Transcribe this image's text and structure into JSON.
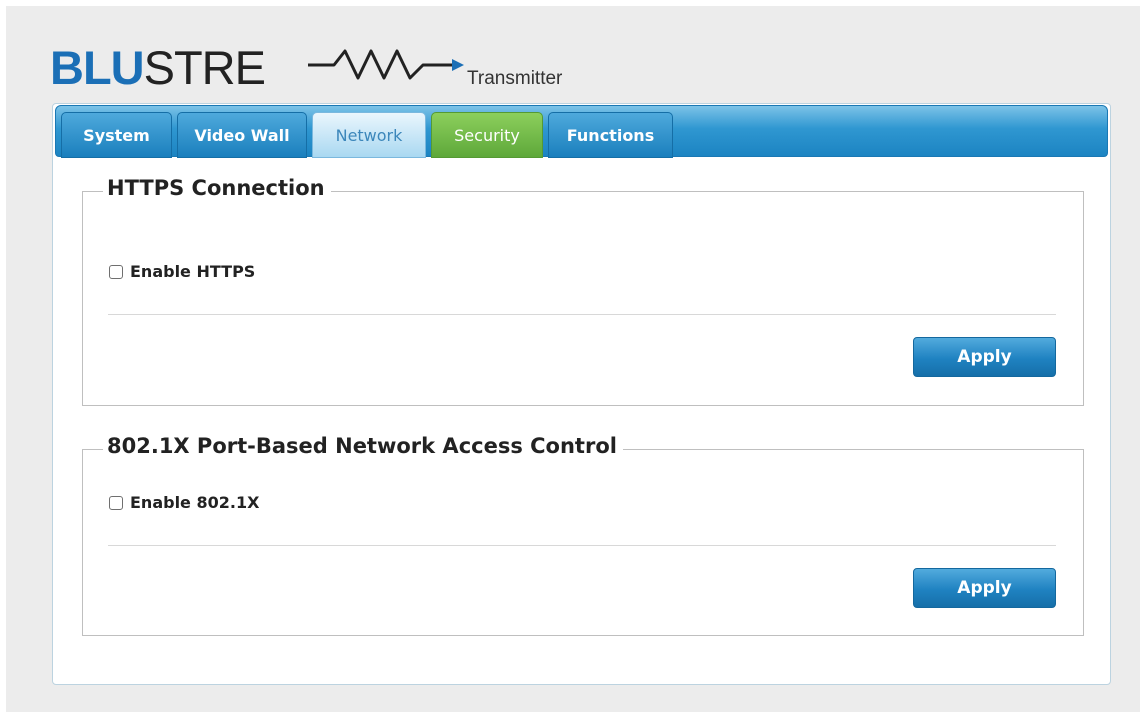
{
  "logo": {
    "brand_part1": "BLU",
    "brand_part2": "STRE",
    "product": "Transmitter"
  },
  "tabs": [
    {
      "label": "System"
    },
    {
      "label": "Video Wall"
    },
    {
      "label": "Network"
    },
    {
      "label": "Security"
    },
    {
      "label": "Functions"
    }
  ],
  "https": {
    "title": "HTTPS Connection",
    "checkbox_label": "Enable HTTPS",
    "checked": false,
    "apply_label": "Apply"
  },
  "dot1x": {
    "title": "802.1X Port-Based Network Access Control",
    "checkbox_label": "Enable 802.1X",
    "checked": false,
    "apply_label": "Apply"
  },
  "colors": {
    "brand_blue": "#1b6fb6",
    "tab_blue": "#1a7fbd",
    "security_green": "#5ea83a",
    "active_tab": "#a9d8f1"
  }
}
